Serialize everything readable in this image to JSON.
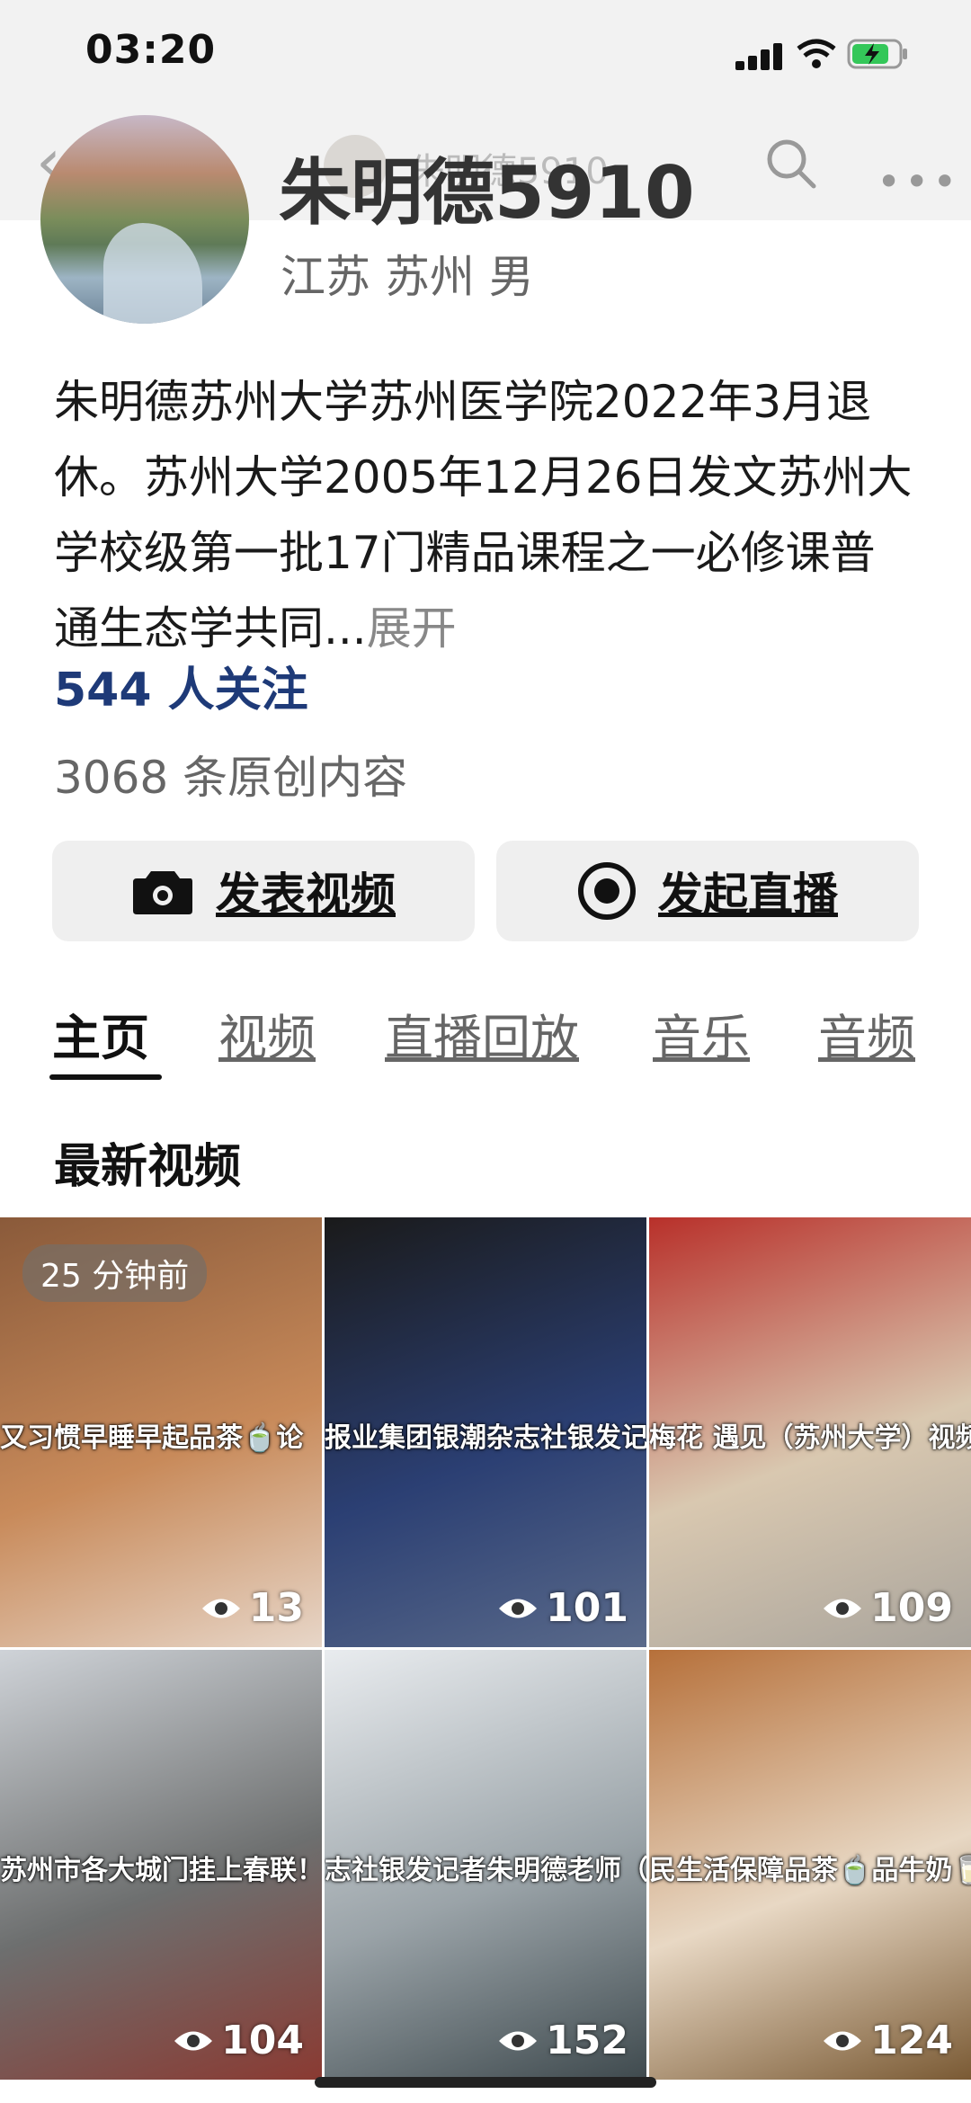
{
  "status": {
    "time": "03:20"
  },
  "nav": {
    "name": "朱明德5910"
  },
  "profile": {
    "name": "朱明德5910",
    "location": "江苏 苏州 男",
    "bio": "朱明德苏州大学苏州医学院2022年3月退休。苏州大学2005年12月26日发文苏州大学校级第一批17门精品课程之一必修课普通生态学共同...",
    "expand": "展开",
    "followers": "544 人关注",
    "original": "3068 条原创内容"
  },
  "actions": {
    "post_video": "发表视频",
    "go_live": "发起直播"
  },
  "tabs": [
    "主页",
    "视频",
    "直播回放",
    "音乐",
    "音频"
  ],
  "section_title": "最新视频",
  "videos": [
    {
      "badge": "25 分钟前",
      "caption": "又习惯早睡早起品茶🍵论",
      "views": "13",
      "colors": [
        "#8a5a3a",
        "#c88a5a",
        "#e7d6c8"
      ]
    },
    {
      "caption": "报业集团银潮杂志社银发记者朱老师（苏州大学）视频新闻报道",
      "views": "101",
      "colors": [
        "#1a1a1a",
        "#2b3f73",
        "#5a6a8a"
      ]
    },
    {
      "caption": "梅花 遇见（苏州大学）视频新闻报道",
      "views": "109",
      "colors": [
        "#b8302a",
        "#d9c8b0",
        "#a9a49c"
      ]
    },
    {
      "caption": "苏州市各大城门挂上春联！",
      "views": "104",
      "colors": [
        "#cfd3d8",
        "#6d6f6f",
        "#8a3a32"
      ]
    },
    {
      "caption": "志社银发记者朱明德老师（苏州",
      "views": "152",
      "colors": [
        "#e9ecef",
        "#9aa3a8",
        "#3f4a4e"
      ]
    },
    {
      "caption": "民生活保障品茶🍵品牛奶🥛品黑茶",
      "views": "124",
      "colors": [
        "#b6703a",
        "#e8d8c4",
        "#7a5a34"
      ]
    }
  ]
}
